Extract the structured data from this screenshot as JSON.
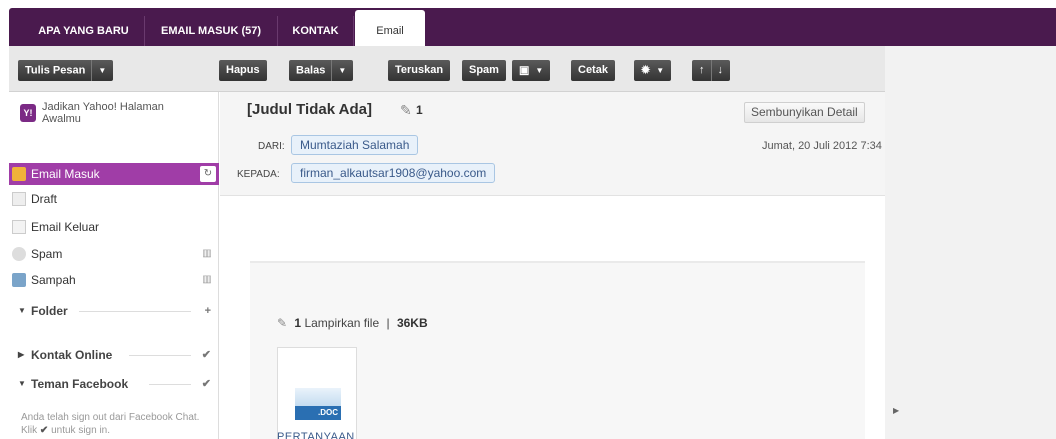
{
  "tabs": {
    "t1": "APA YANG BARU",
    "t2": "EMAIL MASUK (57)",
    "t3": "KONTAK",
    "active": "Email"
  },
  "toolbar": {
    "compose": "Tulis Pesan",
    "delete": "Hapus",
    "reply": "Balas",
    "forward": "Teruskan",
    "spam": "Spam",
    "print": "Cetak"
  },
  "promo": {
    "logo": "Y!",
    "text": "Jadikan Yahoo! Halaman Awalmu"
  },
  "sidebar": {
    "inbox": "Email Masuk",
    "draft": "Draft",
    "sent": "Email Keluar",
    "spam": "Spam",
    "trash": "Sampah",
    "folder": "Folder",
    "online": "Kontak Online",
    "facebook": "Teman Facebook",
    "fb_note": "Anda telah sign out dari Facebook Chat. Klik",
    "fb_note2": "untuk sign in."
  },
  "message": {
    "subject": "[Judul Tidak Ada]",
    "attach_count": "1",
    "hide_details": "Sembunyikan Detail",
    "from_label": "DARI:",
    "from": "Mumtaziah Salamah",
    "to_label": "KEPADA:",
    "to": "firman_alkautsar1908@yahoo.com",
    "date": "Jumat, 20 Juli 2012 7:34"
  },
  "attachment": {
    "count": "1",
    "label": "Lampirkan file",
    "separator": "|",
    "size": "36KB",
    "ext": ".DOC",
    "name": "PERTANYAAN"
  }
}
